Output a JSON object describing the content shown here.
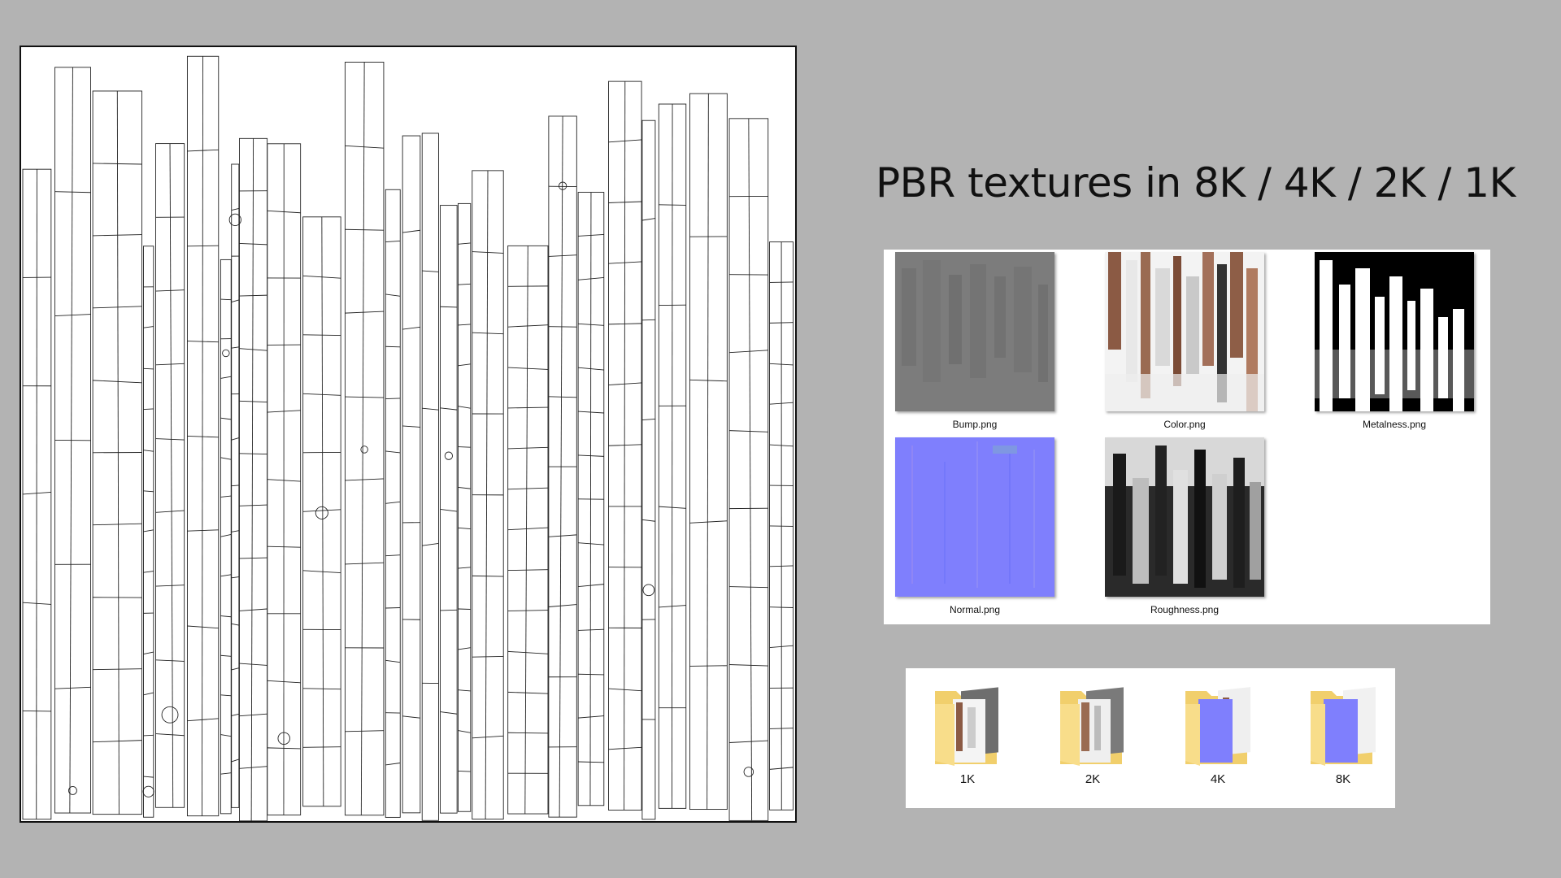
{
  "title": "PBR textures in 8K / 4K / 2K / 1K",
  "textures": [
    {
      "label": "Bump.png",
      "icon": "bump-map-thumbnail",
      "color": "#808080"
    },
    {
      "label": "Color.png",
      "icon": "color-map-thumbnail",
      "color": "#8b5a44"
    },
    {
      "label": "Metalness.png",
      "icon": "metalness-map-thumbnail",
      "color": "#000000"
    },
    {
      "label": "Normal.png",
      "icon": "normal-map-thumbnail",
      "color": "#7f7ffd"
    },
    {
      "label": "Roughness.png",
      "icon": "roughness-map-thumbnail",
      "color": "#2a2a2a"
    }
  ],
  "folders": [
    {
      "label": "1K",
      "icon": "folder-icon",
      "preview_color": "#6e6e6e"
    },
    {
      "label": "2K",
      "icon": "folder-icon",
      "preview_color": "#7a7a7a"
    },
    {
      "label": "4K",
      "icon": "folder-icon",
      "preview_color": "#7f7ffd"
    },
    {
      "label": "8K",
      "icon": "folder-icon",
      "preview_color": "#7f7ffd"
    }
  ],
  "colors": {
    "background": "#b3b3b3",
    "folder": "#f6d77a"
  }
}
